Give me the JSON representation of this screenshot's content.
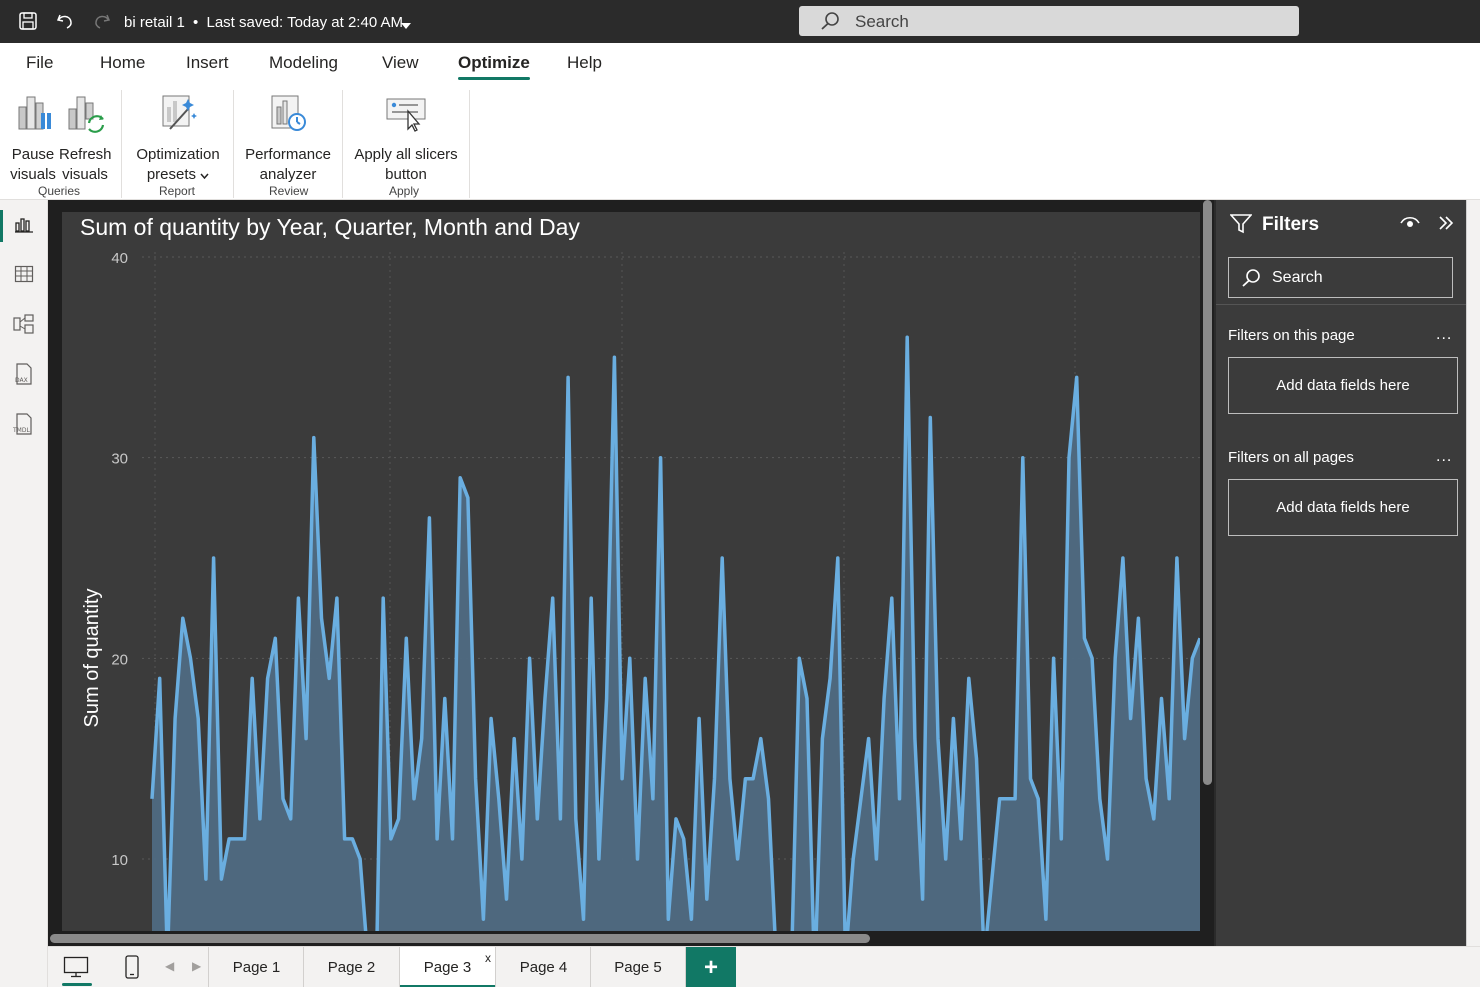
{
  "titlebar": {
    "file_name": "bi retail 1",
    "separator": "•",
    "save_status": "Last saved: Today at 2:40 AM",
    "search_placeholder": "Search"
  },
  "ribbon": {
    "tabs": [
      "File",
      "Home",
      "Insert",
      "Modeling",
      "View",
      "Optimize",
      "Help"
    ],
    "active_tab": "Optimize",
    "buttons": {
      "pause": [
        "Pause",
        "visuals"
      ],
      "refresh": [
        "Refresh",
        "visuals"
      ],
      "presets": [
        "Optimization",
        "presets"
      ],
      "perf": [
        "Performance",
        "analyzer"
      ],
      "apply": [
        "Apply all slicers",
        "button"
      ]
    },
    "groups": {
      "queries": "Queries",
      "report": "Report",
      "review": "Review",
      "apply": "Apply"
    }
  },
  "filters": {
    "title": "Filters",
    "search_placeholder": "Search",
    "this_page_label": "Filters on this page",
    "all_pages_label": "Filters on all pages",
    "drop_label": "Add data fields here",
    "more": "..."
  },
  "pages": {
    "tabs": [
      "Page 1",
      "Page 2",
      "Page 3",
      "Page 4",
      "Page 5"
    ],
    "active": "Page 3",
    "close": "x",
    "add": "+"
  },
  "colors": {
    "accent": "#117865",
    "line": "#6aaee0",
    "area": "#4f6a82",
    "visual_bg": "#3b3b3b"
  },
  "chart_data": {
    "type": "area",
    "title": "Sum of quantity by Year, Quarter, Month and Day",
    "xlabel": "",
    "ylabel": "Sum of quantity",
    "ylim": [
      6.5,
      40.5
    ],
    "yticks": [
      10,
      20,
      30,
      40
    ],
    "grid": true,
    "series": [
      {
        "values": [
          13,
          19,
          5,
          17,
          22,
          20,
          17,
          9,
          25,
          9,
          11,
          11,
          11,
          19,
          12,
          19,
          21,
          13,
          12,
          23,
          16,
          31,
          22,
          19,
          23,
          11,
          11,
          10,
          5,
          2,
          23,
          11,
          12,
          21,
          13,
          16,
          27,
          11,
          18,
          11,
          29,
          28,
          14,
          7,
          17,
          13,
          8,
          16,
          10,
          20,
          12,
          18,
          23,
          12,
          34,
          12,
          7,
          23,
          10,
          18,
          35,
          14,
          20,
          10,
          19,
          13,
          30,
          7,
          12,
          11,
          7,
          17,
          8,
          14,
          25,
          14,
          10,
          14,
          14,
          16,
          13,
          5,
          6,
          5,
          20,
          18,
          4,
          16,
          19,
          25,
          5,
          10,
          13,
          16,
          10,
          18,
          23,
          13,
          36,
          16,
          8,
          32,
          16,
          10,
          17,
          11,
          19,
          15,
          5,
          9,
          13,
          13,
          13,
          30,
          14,
          13,
          7,
          20,
          11,
          30,
          34,
          21,
          20,
          13,
          10,
          20,
          25,
          17,
          22,
          14,
          12,
          18,
          13,
          25,
          16,
          20,
          21
        ]
      }
    ]
  }
}
